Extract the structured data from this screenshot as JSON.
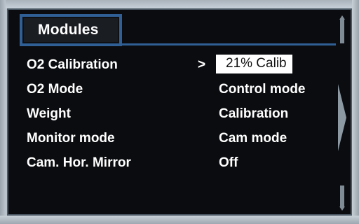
{
  "colors": {
    "screen_bg": "#0b0c0f",
    "accent_border": "#2f5f94",
    "text": "#ffffff",
    "selected_bg": "#ffffff",
    "selected_text": "#111111"
  },
  "header": {
    "title": "Modules"
  },
  "menu": {
    "items": [
      {
        "label": "O2 Calibration",
        "value": "21% Calib",
        "selected": true,
        "cursor": ">"
      },
      {
        "label": "O2 Mode",
        "value": "Control mode"
      },
      {
        "label": "Weight",
        "value": "Calibration"
      },
      {
        "label": "Monitor mode",
        "value": "Cam mode"
      },
      {
        "label": "Cam. Hor. Mirror",
        "value": "Off"
      }
    ]
  },
  "scrollbar": {
    "up_icon": "scroll-up-arrow-icon",
    "thumb_icon": "scroll-thumb-triangle-icon",
    "down_icon": "scroll-down-arrow-icon"
  }
}
